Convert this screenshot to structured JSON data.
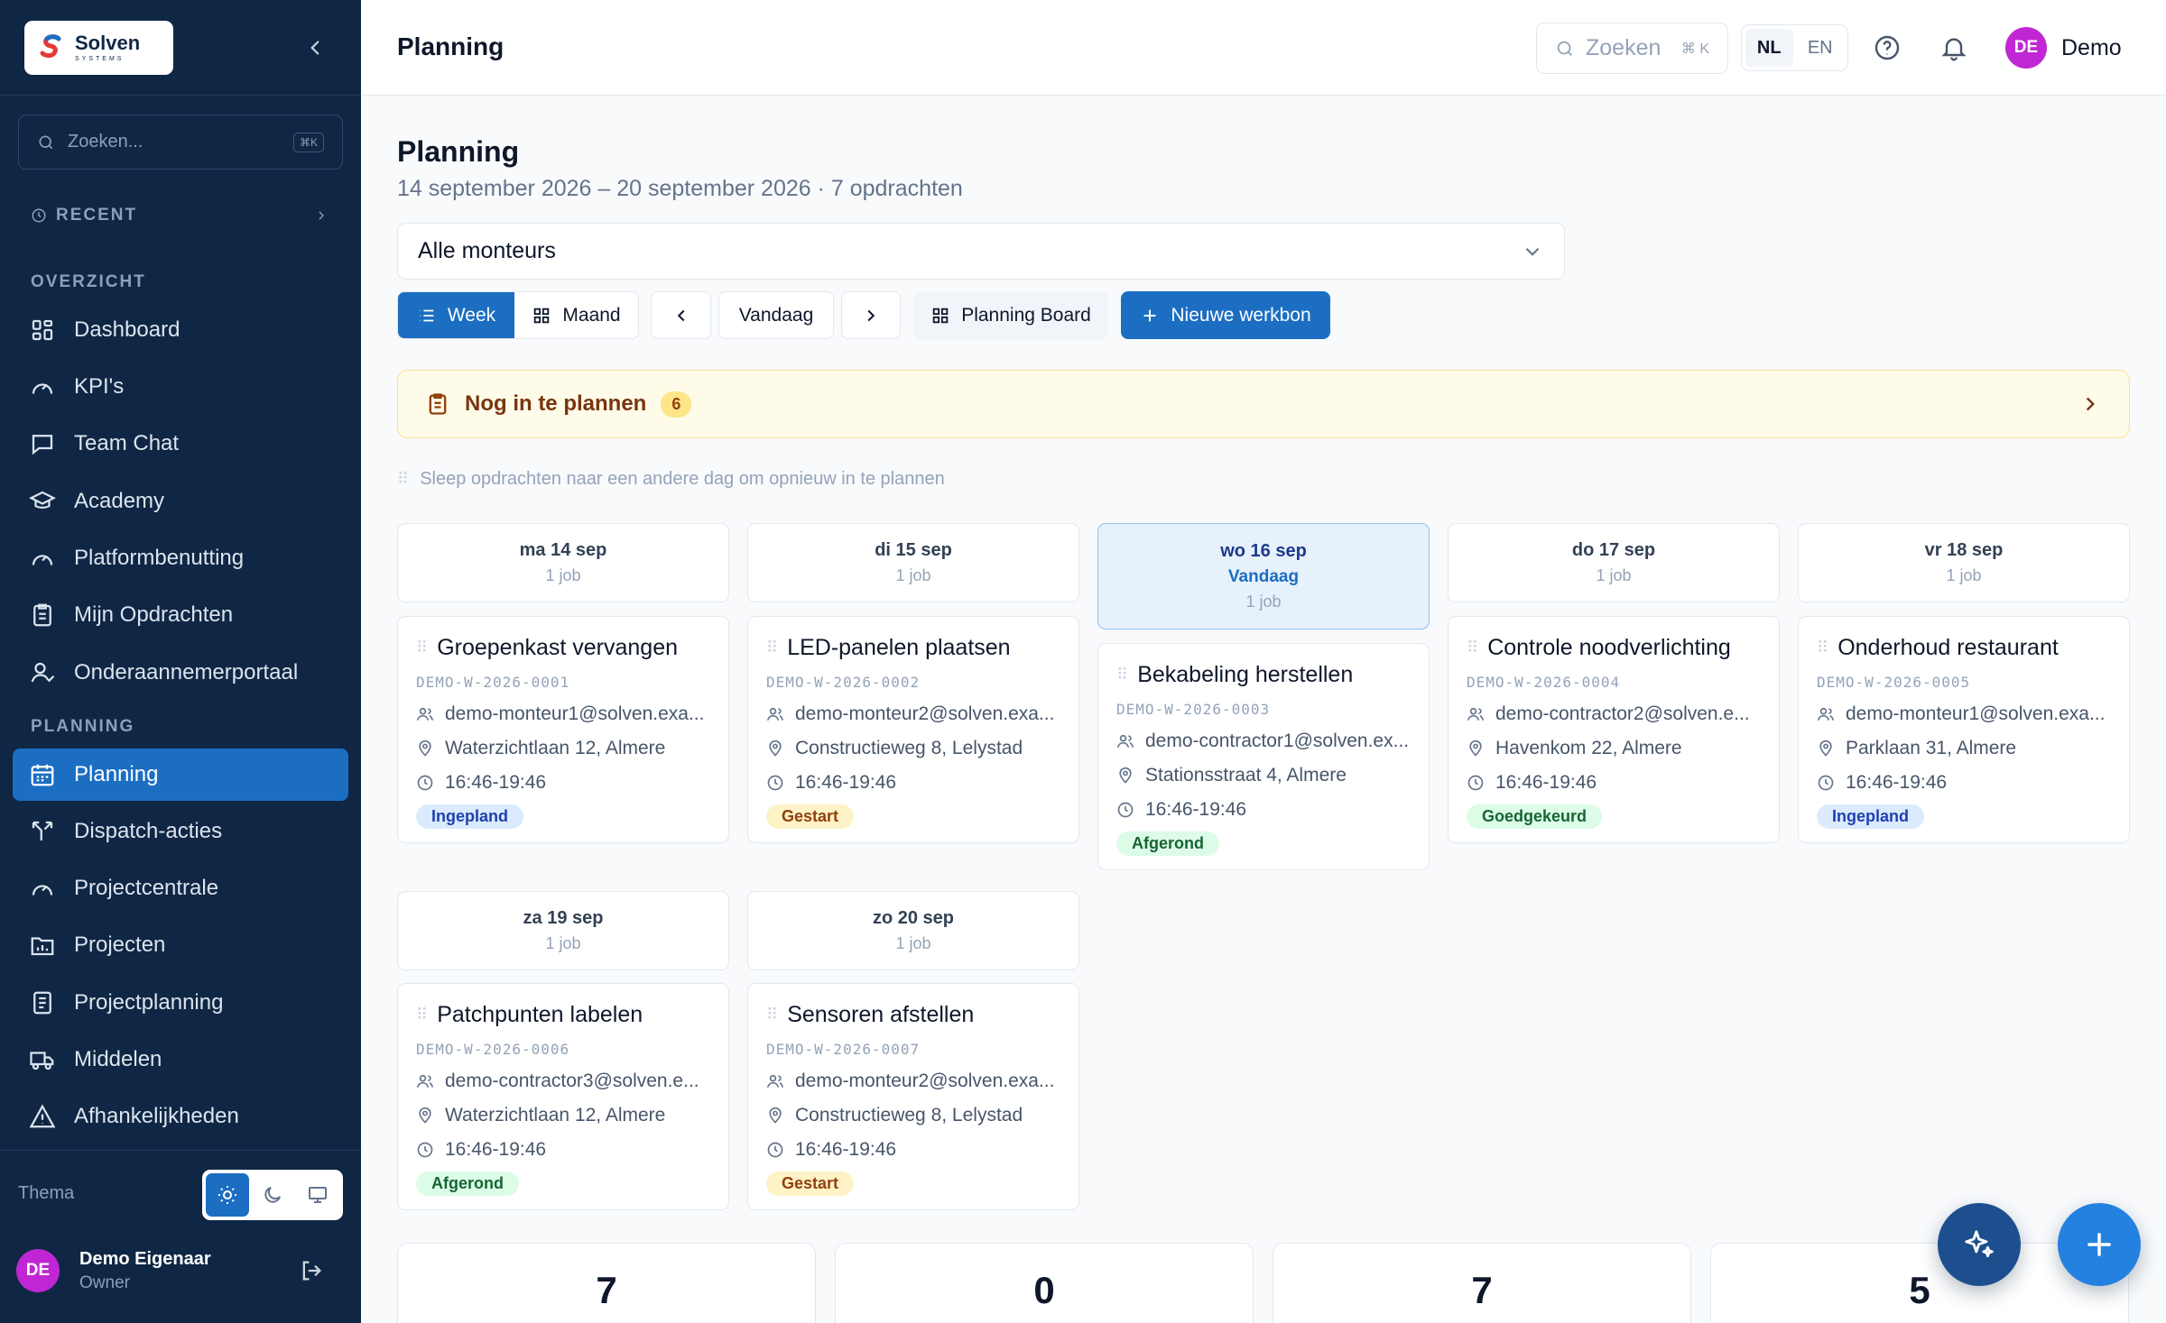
{
  "brand": {
    "name": "Solven",
    "sub": "SYSTEMS"
  },
  "sidebar": {
    "search_placeholder": "Zoeken...",
    "search_kbd": "⌘K",
    "recent_label": "RECENT",
    "sections": [
      {
        "label": "OVERZICHT"
      },
      {
        "label": "PLANNING"
      }
    ],
    "items": [
      {
        "label": "Dashboard",
        "icon": "grid-icon"
      },
      {
        "label": "KPI's",
        "icon": "gauge-icon"
      },
      {
        "label": "Team Chat",
        "icon": "chat-icon"
      },
      {
        "label": "Academy",
        "icon": "graduation-cap-icon"
      },
      {
        "label": "Platformbenutting",
        "icon": "gauge-icon"
      },
      {
        "label": "Mijn Opdrachten",
        "icon": "clipboard-icon"
      },
      {
        "label": "Onderaannemerportaal",
        "icon": "user-check-icon"
      },
      {
        "label": "Planning",
        "icon": "calendar-icon"
      },
      {
        "label": "Dispatch-acties",
        "icon": "split-icon"
      },
      {
        "label": "Projectcentrale",
        "icon": "gauge-icon"
      },
      {
        "label": "Projecten",
        "icon": "chart-folder-icon"
      },
      {
        "label": "Projectplanning",
        "icon": "document-icon"
      },
      {
        "label": "Middelen",
        "icon": "truck-icon"
      },
      {
        "label": "Afhankelijkheden",
        "icon": "warning-icon"
      }
    ],
    "theme_label": "Thema",
    "user": {
      "initials": "DE",
      "name": "Demo Eigenaar",
      "role": "Owner"
    }
  },
  "topbar": {
    "title": "Planning",
    "search_placeholder": "Zoeken",
    "search_kbd": "⌘ K",
    "lang": [
      "NL",
      "EN"
    ],
    "user": {
      "initials": "DE",
      "name": "Demo"
    }
  },
  "main": {
    "title": "Planning",
    "subtitle": "14 september 2026 – 20 september 2026 · 7 opdrachten",
    "filter_value": "Alle monteurs",
    "toolbar": {
      "week": "Week",
      "maand": "Maand",
      "vandaag": "Vandaag",
      "board": "Planning Board",
      "new": "Nieuwe werkbon"
    },
    "unplanned": {
      "label": "Nog in te plannen",
      "count": "6"
    },
    "drag_hint": "Sleep opdrachten naar een andere dag om opnieuw in te plannen",
    "days": [
      {
        "name": "ma 14 sep",
        "count": "1 job",
        "today": ""
      },
      {
        "name": "di 15 sep",
        "count": "1 job",
        "today": ""
      },
      {
        "name": "wo 16 sep",
        "count": "1 job",
        "today": "Vandaag"
      },
      {
        "name": "do 17 sep",
        "count": "1 job",
        "today": ""
      },
      {
        "name": "vr 18 sep",
        "count": "1 job",
        "today": ""
      },
      {
        "name": "za 19 sep",
        "count": "1 job",
        "today": ""
      },
      {
        "name": "zo 20 sep",
        "count": "1 job",
        "today": ""
      }
    ],
    "jobs": [
      {
        "title": "Groepenkast vervangen",
        "code": "DEMO-W-2026-0001",
        "assignee": "demo-monteur1@solven.exa...",
        "address": "Waterzichtlaan 12, Almere",
        "time": "16:46-19:46",
        "status": "Ingepland"
      },
      {
        "title": "LED-panelen plaatsen",
        "code": "DEMO-W-2026-0002",
        "assignee": "demo-monteur2@solven.exa...",
        "address": "Constructieweg 8, Lelystad",
        "time": "16:46-19:46",
        "status": "Gestart"
      },
      {
        "title": "Bekabeling herstellen",
        "code": "DEMO-W-2026-0003",
        "assignee": "demo-contractor1@solven.ex...",
        "address": "Stationsstraat 4, Almere",
        "time": "16:46-19:46",
        "status": "Afgerond"
      },
      {
        "title": "Controle noodverlichting",
        "code": "DEMO-W-2026-0004",
        "assignee": "demo-contractor2@solven.e...",
        "address": "Havenkom 22, Almere",
        "time": "16:46-19:46",
        "status": "Goedgekeurd"
      },
      {
        "title": "Onderhoud restaurant",
        "code": "DEMO-W-2026-0005",
        "assignee": "demo-monteur1@solven.exa...",
        "address": "Parklaan 31, Almere",
        "time": "16:46-19:46",
        "status": "Ingepland"
      },
      {
        "title": "Patchpunten labelen",
        "code": "DEMO-W-2026-0006",
        "assignee": "demo-contractor3@solven.e...",
        "address": "Waterzichtlaan 12, Almere",
        "time": "16:46-19:46",
        "status": "Afgerond"
      },
      {
        "title": "Sensoren afstellen",
        "code": "DEMO-W-2026-0007",
        "assignee": "demo-monteur2@solven.exa...",
        "address": "Constructieweg 8, Lelystad",
        "time": "16:46-19:46",
        "status": "Gestart"
      }
    ],
    "stats": [
      "7",
      "0",
      "7",
      "5"
    ]
  },
  "colors": {
    "sidebar_bg": "#0f2744",
    "accent": "#1b6ec2",
    "ingepland": "#dbeafe",
    "gestart": "#fef3c7",
    "afgerond": "#dcfce7"
  }
}
